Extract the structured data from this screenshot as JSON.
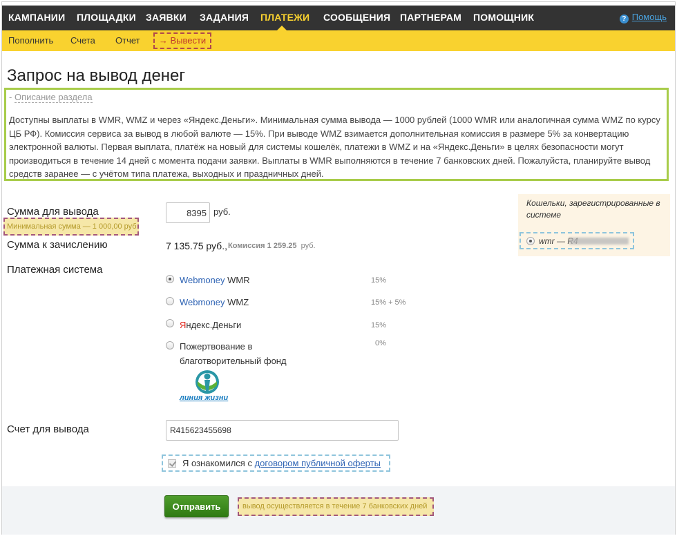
{
  "nav": {
    "items": [
      "КАМПАНИИ",
      "ПЛОЩАДКИ",
      "ЗАЯВКИ",
      "ЗАДАНИЯ",
      "ПЛАТЕЖИ",
      "СООБЩЕНИЯ",
      "ПАРТНЕРАМ",
      "ПОМОЩНИК"
    ],
    "active": "ПЛАТЕЖИ",
    "help_label": "Помощь",
    "help_icon": "question-circle-icon"
  },
  "subnav": {
    "items": [
      "Пополнить",
      "Счета",
      "Отчет"
    ],
    "withdraw": "→ Вывести"
  },
  "page": {
    "title": "Запрос на вывод денег",
    "section_toggle_prefix": "- ",
    "section_toggle": "Описание раздела",
    "description": "Доступны выплаты в WMR, WMZ и через «Яндекс.Деньги». Минимальная сумма вывода — 1000 рублей (1000 WMR или аналогичная сумма WMZ по курсу ЦБ РФ). Комиссия сервиса за вывод в любой валюте — 15%. При выводе WMZ взимается дополнительная комиссия в размере 5% за конвертацию электронной валюты. Первая выплата, платёж на новый для системы кошелёк, платежи в WMZ и на «Яндекс.Деньги» в целях безопасности могут производиться в течение 14 дней с момента подачи заявки. Выплаты в WMR выполняются в течение 7 банковских дней. Пожалуйста, планируйте вывод средств заранее — с учётом типа платежа, выходных и праздничных дней."
  },
  "form": {
    "amount_label": "Сумма для вывода",
    "amount_value": "8395",
    "currency": "руб.",
    "min_sum_hint": "Минимальная сумма — 1 000,00 руб",
    "credit_label": "Сумма к зачислению",
    "credit_value": "7 135.75",
    "credit_currency": "руб.,",
    "commission_label": "Комиссия",
    "commission_value": "1 259.25",
    "commission_currency": "руб.",
    "payment_label": "Платежная система",
    "payment_options": [
      {
        "brand": "Webmoney",
        "suffix": " WMR",
        "pct": "15%",
        "checked": true
      },
      {
        "brand": "Webmoney",
        "suffix": " WMZ",
        "pct": "15% + 5%",
        "checked": false
      },
      {
        "brand_first": "Я",
        "brand_rest": "ндекс.Деньги",
        "pct": "15%",
        "checked": false
      },
      {
        "label_line1": "Пожертвование в",
        "label_line2": "благотворительный фонд",
        "pct": "0%",
        "checked": false
      }
    ],
    "fund_name": "линия жизни",
    "account_label": "Счет для вывода",
    "account_value": "R415623455698",
    "agree_text": "Я ознакомился с ",
    "agree_link": "договором публичной оферты",
    "agree_checked": true
  },
  "wallets": {
    "title": "Кошельки, зарегистрированные в системе",
    "item_prefix": "wmr — R4"
  },
  "footer": {
    "submit": "Отправить",
    "note": "вывод осуществляется в течение 7 банковских дней"
  },
  "colors": {
    "nav_bg": "#333333",
    "accent_yellow": "#f9d22f",
    "desc_border": "#a8cc4a",
    "submit_green": "#3c8a1d",
    "link_blue": "#2e63b4"
  }
}
